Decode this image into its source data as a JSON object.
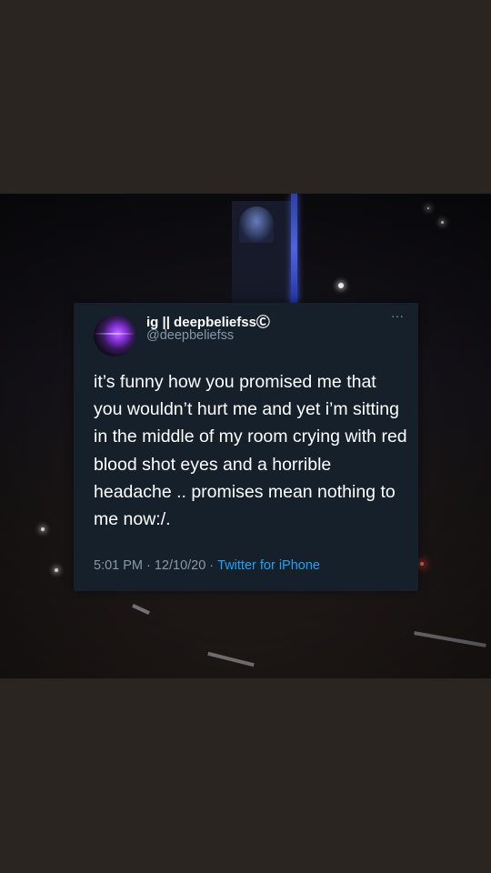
{
  "tweet": {
    "display_name": "ig || deepbeliefssⒸ",
    "handle": "@deepbeliefss",
    "more_label": "···",
    "text": "it’s funny how you promised me that you wouldn’t hurt me and yet i’m sitting in the middle of my room crying with red blood shot eyes and a horrible headache .. promises mean nothing to me now:/.",
    "time": "5:01 PM",
    "date": "12/10/20",
    "separator": "·",
    "source": "Twitter for iPhone"
  },
  "colors": {
    "card_background": "#15202b",
    "secondary_text": "#8899a6",
    "link": "#1da1f2",
    "page_background": "#2a2520"
  }
}
